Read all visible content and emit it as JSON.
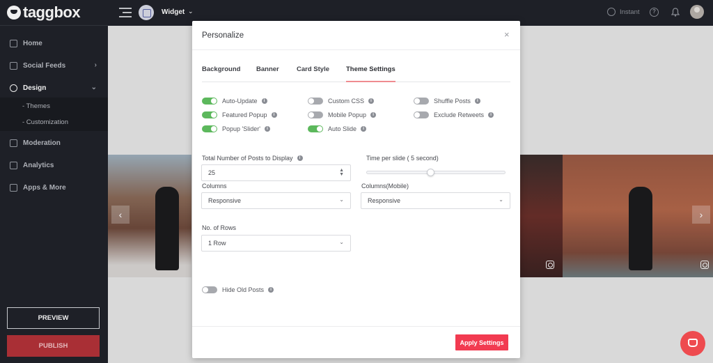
{
  "brand": {
    "logo_text": "taggbox"
  },
  "sidebar": {
    "items": [
      {
        "label": "Home"
      },
      {
        "label": "Social Feeds"
      },
      {
        "label": "Design"
      },
      {
        "label": "Moderation"
      },
      {
        "label": "Analytics"
      },
      {
        "label": "Apps & More"
      }
    ],
    "design_sub": [
      {
        "label": "- Themes"
      },
      {
        "label": "- Customization"
      }
    ],
    "preview_label": "PREVIEW",
    "publish_label": "PUBLISH"
  },
  "topbar": {
    "widget_label": "Widget",
    "instant_label": "Instant"
  },
  "modal": {
    "title": "Personalize",
    "tabs": [
      {
        "label": "Background"
      },
      {
        "label": "Banner"
      },
      {
        "label": "Card Style"
      },
      {
        "label": "Theme Settings",
        "active": true
      }
    ],
    "toggles": [
      {
        "label": "Auto-Update",
        "on": true
      },
      {
        "label": "Custom CSS",
        "on": false
      },
      {
        "label": "Shuffle Posts",
        "on": false
      },
      {
        "label": "Featured Popup",
        "on": true
      },
      {
        "label": "Mobile Popup",
        "on": false
      },
      {
        "label": "Exclude Retweets",
        "on": false
      },
      {
        "label": "Popup 'Slider'",
        "on": true
      },
      {
        "label": "Auto Slide",
        "on": true
      }
    ],
    "posts_label": "Total Number of Posts to Display",
    "posts_value": "25",
    "time_label": "Time per slide ( 5 second)",
    "time_value_fraction": 0.46,
    "columns_label": "Columns",
    "columns_value": "Responsive",
    "columns_mobile_label": "Columns(Mobile)",
    "columns_mobile_value": "Responsive",
    "rows_label": "No. of Rows",
    "rows_value": "1 Row",
    "hide_old_label": "Hide Old Posts",
    "hide_old_on": false,
    "apply_label": "Apply Settings"
  },
  "colors": {
    "accent": "#f23b51",
    "toggle_on": "#5cb85c",
    "sidebar_bg": "#20232a",
    "publish": "#b43239"
  }
}
